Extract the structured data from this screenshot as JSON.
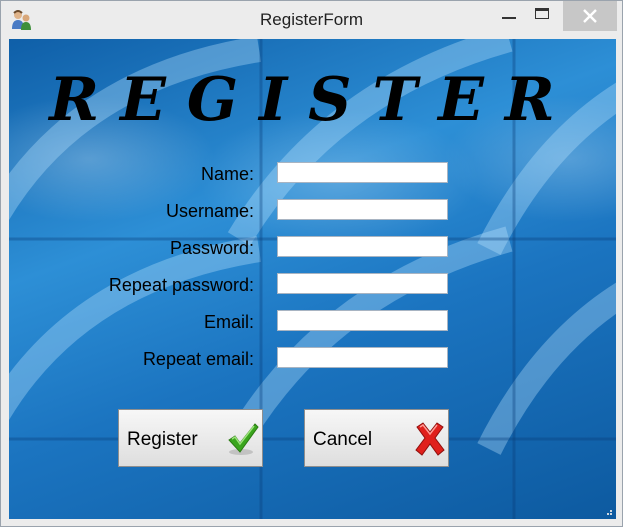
{
  "window": {
    "title": "RegisterForm"
  },
  "form": {
    "heading": "REGISTER",
    "fields": [
      {
        "label": "Name:",
        "value": ""
      },
      {
        "label": "Username:",
        "value": ""
      },
      {
        "label": "Password:",
        "value": ""
      },
      {
        "label": "Repeat password:",
        "value": ""
      },
      {
        "label": "Email:",
        "value": ""
      },
      {
        "label": "Repeat email:",
        "value": ""
      }
    ]
  },
  "buttons": {
    "register_label": "Register",
    "register_icon": "green-checkmark-icon",
    "cancel_label": "Cancel",
    "cancel_icon": "red-x-icon"
  },
  "colors": {
    "background": "#1b74c0",
    "check": "#3aa51d",
    "cross": "#e0201c"
  }
}
